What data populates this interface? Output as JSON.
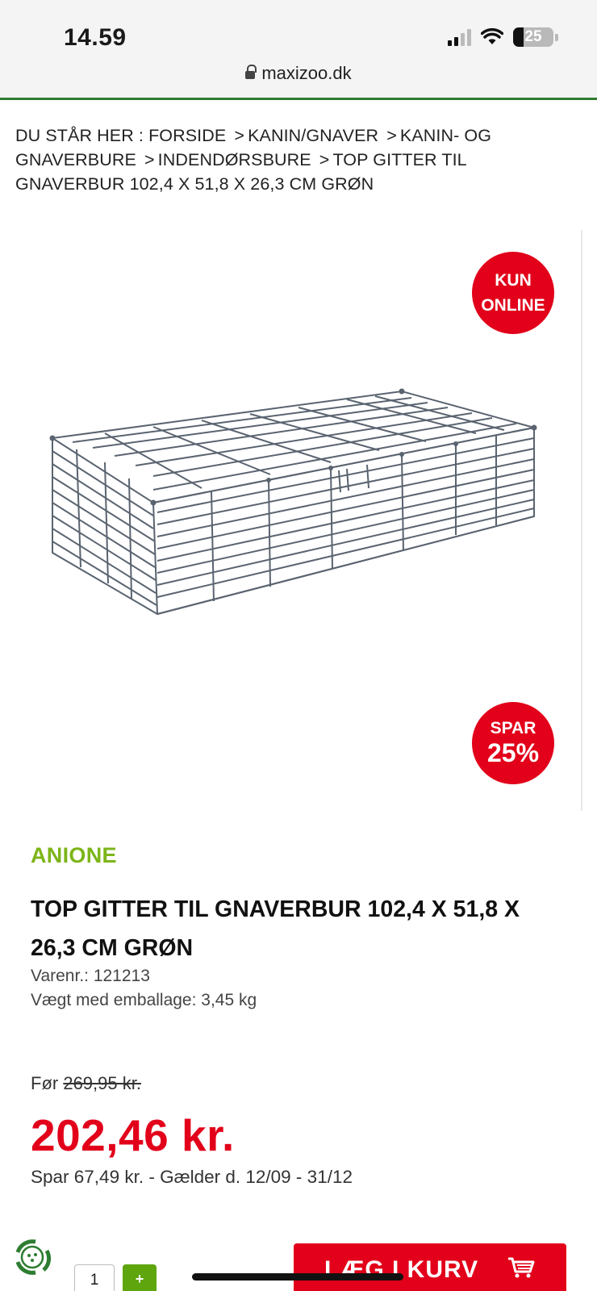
{
  "status_bar": {
    "time": "14.59",
    "battery": "25"
  },
  "browser": {
    "url": "maxizoo.dk"
  },
  "breadcrumb": {
    "prefix": "DU STÅR HER :",
    "items": [
      "FORSIDE",
      "KANIN/GNAVER",
      "KANIN- OG GNAVERBURE",
      "INDENDØRSBURE",
      "TOP GITTER TIL GNAVERBUR 102,4 X 51,8 X 26,3 CM GRØN"
    ],
    "separator": ">"
  },
  "badges": {
    "online_line1": "KUN",
    "online_line2": "ONLINE",
    "save_line1": "SPAR",
    "save_line2": "25%"
  },
  "product": {
    "brand": "ANIONE",
    "title": "TOP GITTER TIL GNAVERBUR 102,4 X 51,8 X 26,3 CM GRØN",
    "sku": "Varenr.: 121213",
    "weight": "Vægt med emballage: 3,45 kg",
    "old_price_label": "Før",
    "old_price": "269,95 kr.",
    "price": "202,46 kr.",
    "save_note": "Spar 67,49 kr. - Gælder d. 12/09 - 31/12"
  },
  "actions": {
    "quantity": "1",
    "plus_label": "+",
    "add_to_cart": "LÆG I KURV"
  },
  "colors": {
    "brand_red": "#e2001a",
    "brand_green": "#7cb518",
    "header_line": "#2e7d32"
  },
  "icons": [
    "lock-icon",
    "signal-icon",
    "wifi-icon",
    "battery-icon",
    "recycle-icon",
    "cart-icon"
  ]
}
